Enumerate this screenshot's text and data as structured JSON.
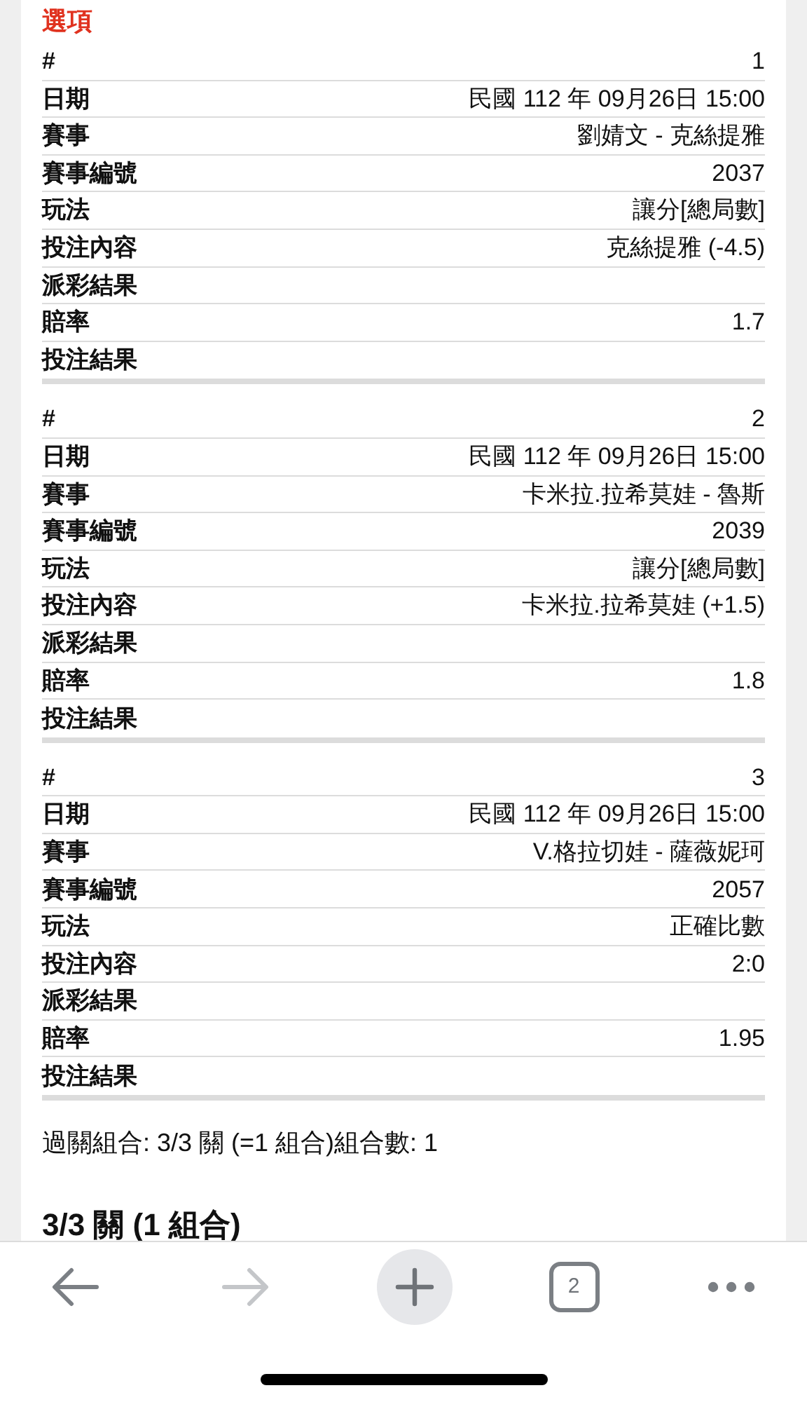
{
  "section_title": "選項",
  "bets": [
    {
      "rows": [
        {
          "label": "#",
          "value": "1"
        },
        {
          "label": "日期",
          "value": "民國 112 年 09月26日 15:00"
        },
        {
          "label": "賽事",
          "value": "劉婧文 - 克絲提雅"
        },
        {
          "label": "賽事編號",
          "value": "2037"
        },
        {
          "label": "玩法",
          "value": "讓分[總局數]"
        },
        {
          "label": "投注內容",
          "value": "克絲提雅 (-4.5)"
        },
        {
          "label": "派彩結果"
        },
        {
          "label": "賠率",
          "value": "1.7"
        },
        {
          "label": "投注結果"
        }
      ]
    },
    {
      "rows": [
        {
          "label": "#",
          "value": "2"
        },
        {
          "label": "日期",
          "value": "民國 112 年 09月26日 15:00"
        },
        {
          "label": "賽事",
          "value": "卡米拉.拉希莫娃 - 魯斯"
        },
        {
          "label": "賽事編號",
          "value": "2039"
        },
        {
          "label": "玩法",
          "value": "讓分[總局數]"
        },
        {
          "label": "投注內容",
          "value": "卡米拉.拉希莫娃 (+1.5)"
        },
        {
          "label": "派彩結果"
        },
        {
          "label": "賠率",
          "value": "1.8"
        },
        {
          "label": "投注結果"
        }
      ]
    },
    {
      "rows": [
        {
          "label": "#",
          "value": "3"
        },
        {
          "label": "日期",
          "value": "民國 112 年 09月26日 15:00"
        },
        {
          "label": "賽事",
          "value": "V.格拉切娃 - 薩薇妮珂"
        },
        {
          "label": "賽事編號",
          "value": "2057"
        },
        {
          "label": "玩法",
          "value": "正確比數"
        },
        {
          "label": "投注內容",
          "value": "2:0"
        },
        {
          "label": "派彩結果"
        },
        {
          "label": "賠率",
          "value": "1.95"
        },
        {
          "label": "投注結果"
        }
      ]
    }
  ],
  "summary": "過關組合: 3/3 關 (=1 組合)組合數: 1",
  "combo_heading": "3/3 關 (1 組合)",
  "toolbar": {
    "items": [
      {
        "kind": "back",
        "disabled": false
      },
      {
        "kind": "forward",
        "disabled": true
      },
      {
        "kind": "new-tab"
      },
      {
        "kind": "tabs",
        "count": "2"
      },
      {
        "kind": "more"
      }
    ]
  }
}
